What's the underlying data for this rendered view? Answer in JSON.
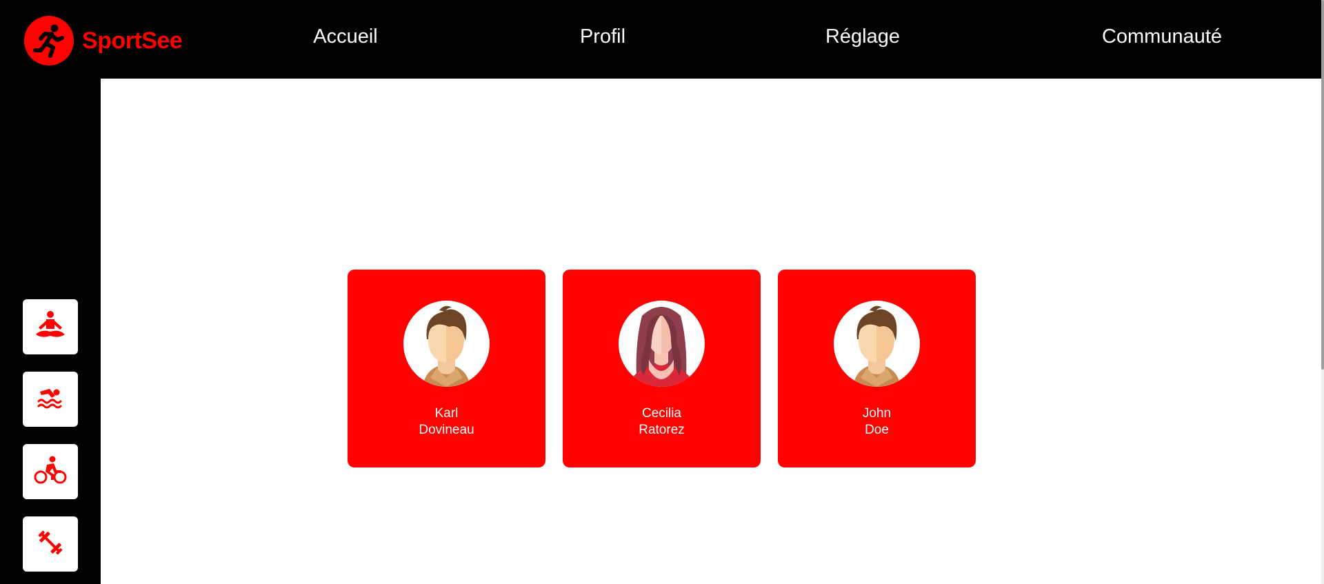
{
  "brand": {
    "name": "SportSee",
    "icon": "runner-icon",
    "color": "#ff0101"
  },
  "nav": {
    "items": [
      {
        "label": "Accueil"
      },
      {
        "label": "Profil"
      },
      {
        "label": "Réglage"
      },
      {
        "label": "Communauté"
      }
    ]
  },
  "sidebar": {
    "items": [
      {
        "icon": "yoga-icon"
      },
      {
        "icon": "swimming-icon"
      },
      {
        "icon": "cycling-icon"
      },
      {
        "icon": "dumbbell-icon"
      }
    ]
  },
  "users": [
    {
      "first_name": "Karl",
      "last_name": "Dovineau",
      "avatar": "male-avatar"
    },
    {
      "first_name": "Cecilia",
      "last_name": "Ratorez",
      "avatar": "female-avatar"
    },
    {
      "first_name": "John",
      "last_name": "Doe",
      "avatar": "male-avatar"
    }
  ]
}
